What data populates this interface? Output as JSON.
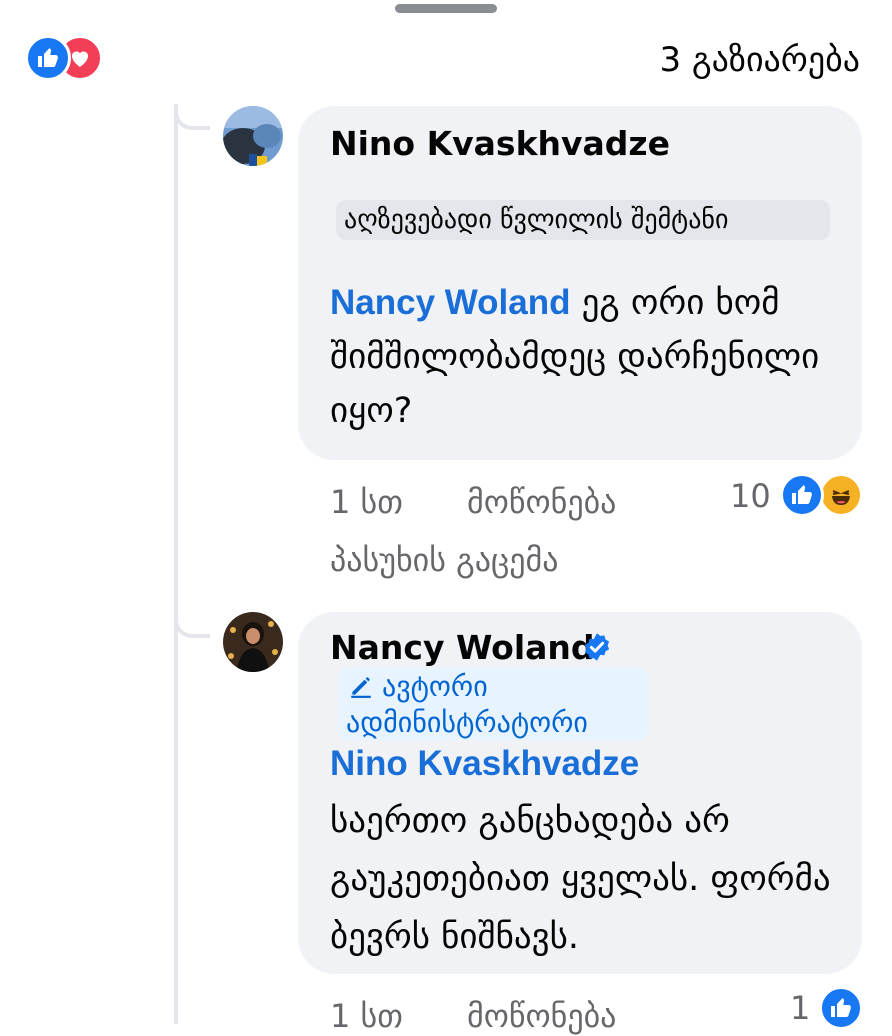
{
  "header": {
    "shares_label": "3 გაზიარება",
    "reaction_icons": [
      "like-icon",
      "love-icon"
    ]
  },
  "comments": [
    {
      "author": "Nino Kvaskhvadze",
      "attachment_label": "აღზევებადი წვლილის შემტანი",
      "mention": "Nancy Woland",
      "text": " ეგ ორი ხომ შიმშილობამდეც დარჩენილი იყო?",
      "time": "1 სთ",
      "like_action": "მოწონება",
      "reply_action": "პასუხის გაცემა",
      "reaction_count": "10",
      "reaction_icons": [
        "like-icon",
        "haha-icon"
      ]
    },
    {
      "author": "Nancy Woland",
      "verified": true,
      "badge_icon": "pencil-icon",
      "badge_label_line1": "ავტორი",
      "badge_label_line2": "ადმინისტრატორი",
      "mention": "Nino Kvaskhvadze",
      "text": "საერთო განცხადება არ გაუკეთებიათ ყველას. ფორმა ბევრს ნიშნავს.",
      "time": "1 სთ",
      "like_action": "მოწონება",
      "reaction_count": "1",
      "reaction_icons": [
        "like-icon"
      ]
    }
  ],
  "colors": {
    "link_blue": "#1a6ed8",
    "bubble_bg": "#f0f2f5",
    "meta_gray": "#65676b",
    "like_blue": "#1877f2",
    "love_red": "#f33e58"
  }
}
